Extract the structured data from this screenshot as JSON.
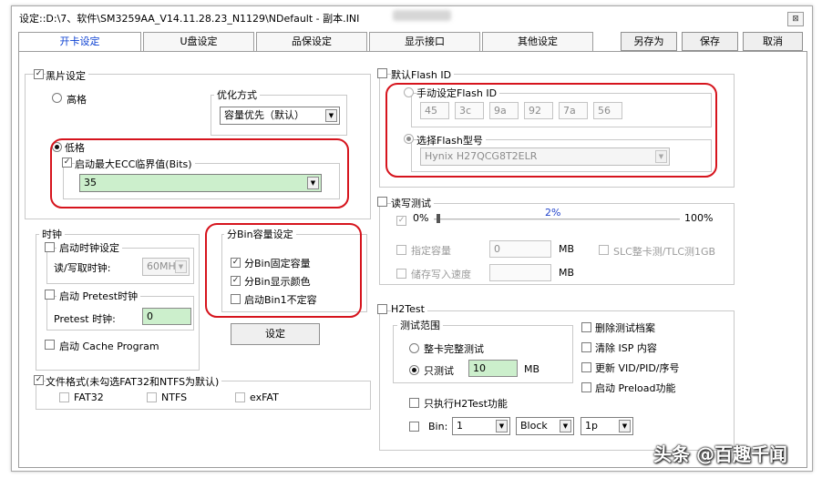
{
  "window": {
    "title": "设定::D:\\7、软件\\SM3259AA_V14.11.28.23_N1129\\NDefault - 副本.INI",
    "close_label": "⊠"
  },
  "tabs": [
    "开卡设定",
    "U盘设定",
    "品保设定",
    "显示接口",
    "其他设定"
  ],
  "buttons": {
    "save_as": "另存为",
    "save": "保存",
    "cancel": "取消",
    "setup": "设定"
  },
  "black_card": {
    "label": "黑片设定",
    "checked": true,
    "high_grade": "高格",
    "optimize_label": "优化方式",
    "optimize_value": "容量优先（默认）",
    "low_grade": "低格",
    "ecc_label": "启动最大ECC临界值(Bits)",
    "ecc_value": "35"
  },
  "clock": {
    "label": "时钟",
    "enable_clock": "启动时钟设定",
    "rw_clock_label": "读/写取时钟:",
    "rw_clock_value": "60MHz",
    "pretest_enable": "启动 Pretest时钟",
    "pretest_label": "Pretest 时钟:",
    "pretest_value": "0",
    "cache_program": "启动 Cache Program"
  },
  "bin": {
    "label": "分Bin容量设定",
    "fixed_capacity": "分Bin固定容量",
    "show_color": "分Bin显示颜色",
    "bin1_unfixed": "启动Bin1不定容"
  },
  "file_format": {
    "label": "文件格式(未勾选FAT32和NTFS为默认)",
    "options": [
      "FAT32",
      "NTFS",
      "exFAT"
    ]
  },
  "flash_id": {
    "label": "默认Flash ID",
    "manual_label": "手动设定Flash ID",
    "bytes": [
      "45",
      "3c",
      "9a",
      "92",
      "7a",
      "56"
    ],
    "select_model_label": "选择Flash型号",
    "model_value": "Hynix H27QCG8T2ELR"
  },
  "rw_test": {
    "label": "读写测试",
    "min": "0%",
    "value": "2%",
    "max": "100%",
    "percent": 2,
    "capacity_label": "指定容量",
    "capacity_value": "0",
    "capacity_unit": "MB",
    "slc_label": "SLC整卡测/TLC测1GB",
    "write_speed_label": "储存写入速度",
    "write_speed_unit": "MB"
  },
  "h2test": {
    "label": "H2Test",
    "range_label": "测试范围",
    "full_card": "整卡完整测试",
    "only_test": "只测试",
    "only_value": "10",
    "only_unit": "MB",
    "delete_file": "删除测试档案",
    "clear_isp": "清除 ISP 内容",
    "update_vid": "更新 VID/PID/序号",
    "preload": "启动 Preload功能",
    "only_h2test": "只执行H2Test功能",
    "bin_label": "Bin:",
    "bin_value": "1",
    "block_value": "Block",
    "p_value": "1p"
  },
  "watermark": "头条 @百趣千闻"
}
